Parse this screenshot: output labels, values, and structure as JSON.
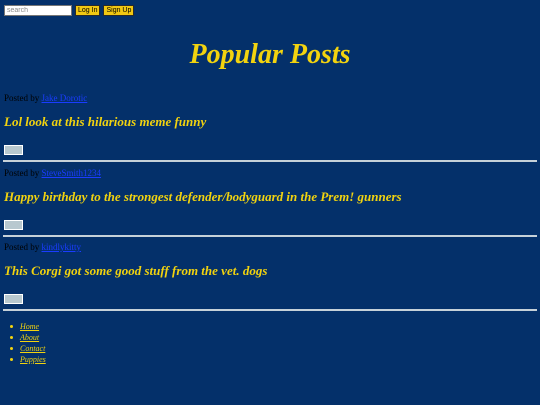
{
  "header": {
    "search_placeholder": "search",
    "login_label": "Log In",
    "signup_label": "Sign Up"
  },
  "page_title": "Popular Posts",
  "posts": [
    {
      "posted_by_label": "Posted by",
      "author": "Jake Dorotic",
      "title": "Lol look at this hilarious meme funny"
    },
    {
      "posted_by_label": "Posted by",
      "author": "SteveSmith1234",
      "title": "Happy birthday to the strongest defender/bodyguard in the Prem! gunners"
    },
    {
      "posted_by_label": "Posted by",
      "author": "kindlykitty",
      "title": "This Corgi got some good stuff from the vet. dogs"
    }
  ],
  "footer_nav": [
    "Home",
    "About",
    "Contact",
    "Puppies"
  ],
  "colors": {
    "background": "#04306a",
    "accent": "#f2d30f",
    "button": "#f2c812",
    "link": "#1a3cff"
  }
}
